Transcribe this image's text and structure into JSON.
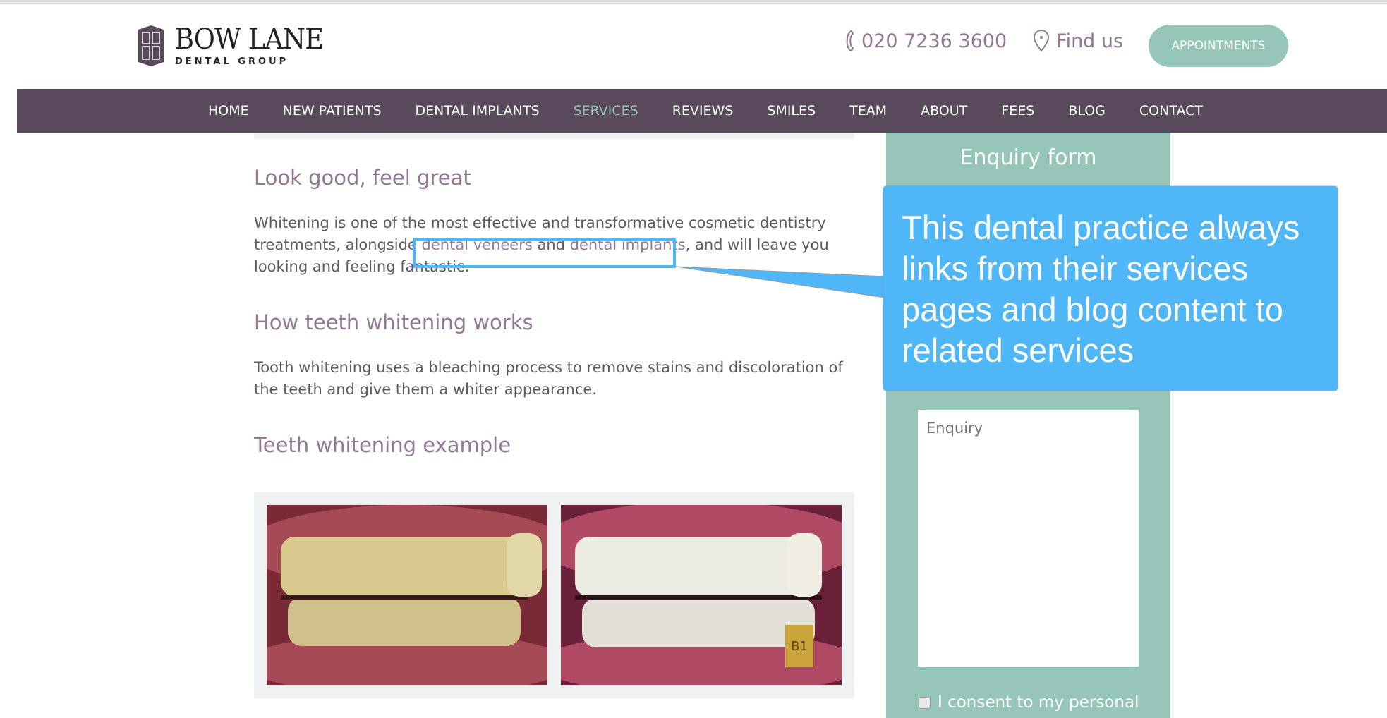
{
  "header": {
    "logo_title": "BOW LANE",
    "logo_subtitle": "DENTAL GROUP",
    "phone": "020 7236 3600",
    "find_us": "Find us",
    "appointments": "APPOINTMENTS",
    "icons": {
      "phone": "phone-icon",
      "location": "map-pin-icon"
    }
  },
  "nav": {
    "items": [
      {
        "label": "HOME"
      },
      {
        "label": "NEW PATIENTS"
      },
      {
        "label": "DENTAL IMPLANTS"
      },
      {
        "label": "SERVICES",
        "active": true
      },
      {
        "label": "REVIEWS"
      },
      {
        "label": "SMILES"
      },
      {
        "label": "TEAM"
      },
      {
        "label": "ABOUT"
      },
      {
        "label": "FEES"
      },
      {
        "label": "BLOG"
      },
      {
        "label": "CONTACT"
      }
    ]
  },
  "content": {
    "h1": "Look good, feel great",
    "p1_a": "Whitening is one of the most effective and transformative cosmetic dentistry treatments, alongside ",
    "link1": "dental veneers",
    "p1_b": " and ",
    "link2": "dental implants",
    "p1_c": ", and will leave you looking and feeling fantastic.",
    "h2": "How teeth whitening works",
    "p2": "Tooth whitening uses a bleaching process to remove stains and discoloration of the teeth and give them a whiter appearance.",
    "h3": "Teeth whitening example",
    "shade_label": "B1"
  },
  "sidebar": {
    "title": "Enquiry form",
    "enquiry_placeholder": "Enquiry",
    "consent": "I consent to my personal"
  },
  "callout": {
    "text": "This dental practice always links from their services pages and blog content to related services"
  },
  "colors": {
    "brand_purple": "#5a485c",
    "accent_mauve": "#947896",
    "mint": "#95c6b9",
    "callout_blue": "#4fb7f7"
  }
}
